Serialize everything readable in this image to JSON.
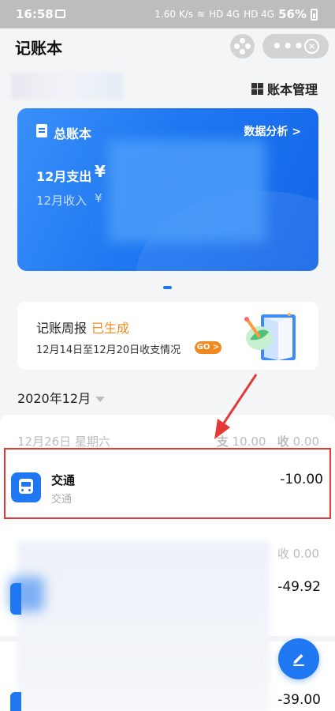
{
  "status_bar": {
    "time": "16:58",
    "speed": "1.60 K/s",
    "network1": "HD 4G",
    "network2": "HD 4G",
    "battery": "56%"
  },
  "header": {
    "title": "记账本",
    "more_label": "•••",
    "close_label": "×"
  },
  "account_manage": "账本管理",
  "ledger_card": {
    "name": "总账本",
    "analysis_link": "数据分析 >",
    "expense_label": "12月支出",
    "expense_currency": "¥",
    "income_label": "12月收入",
    "income_currency": "¥"
  },
  "weekly_report": {
    "title": "记账周报",
    "status": "已生成",
    "description": "12月14日至12月20日收支情况",
    "go_label": "GO >"
  },
  "month_selector": "2020年12月",
  "day_group": {
    "date": "12月26日 星期六",
    "expense_prefix": "支",
    "expense_value": "10.00",
    "income_prefix": "收",
    "income_value": "0.00"
  },
  "record": {
    "name": "交通",
    "category": "交通",
    "amount": "-10.00"
  },
  "blurred_group": {
    "income_summary": "收 0.00",
    "amount": "-49.92"
  },
  "blurred_group_2": {
    "amount": "-39.00"
  },
  "colors": {
    "accent": "#1f78f2",
    "highlight_border": "#e53935",
    "status_orange": "#f0891e"
  }
}
